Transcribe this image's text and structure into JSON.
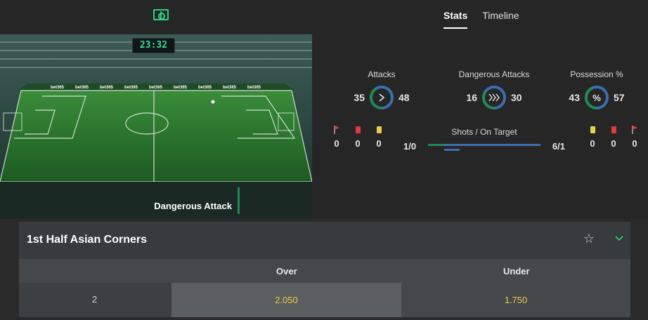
{
  "header": {
    "pitch_icon": "pitch-icon",
    "tabs": [
      {
        "label": "Stats",
        "active": true
      },
      {
        "label": "Timeline",
        "active": false
      }
    ]
  },
  "match": {
    "clock": "23:32",
    "event": "Dangerous Attack",
    "board_text": "bet365"
  },
  "stats": {
    "attacks": {
      "title": "Attacks",
      "home": "35",
      "away": "48",
      "icon": "chevron-right-icon"
    },
    "dangerous_attacks": {
      "title": "Dangerous Attacks",
      "home": "16",
      "away": "30",
      "icon": "triple-chevron-icon"
    },
    "possession": {
      "title": "Possession %",
      "home": "43",
      "away": "57",
      "icon": "percent-icon"
    },
    "home_cards": {
      "corners": "0",
      "red": "0",
      "yellow": "0"
    },
    "away_cards": {
      "yellow": "0",
      "red": "0",
      "corners": "0"
    },
    "shots": {
      "title": "Shots / On Target",
      "home": "1/0",
      "away": "6/1"
    }
  },
  "market": {
    "title": "1st Half Asian Corners",
    "columns": {
      "over": "Over",
      "under": "Under"
    },
    "rows": [
      {
        "line": "2",
        "over": "2.050",
        "under": "1.750"
      }
    ]
  },
  "colors": {
    "accent_green": "#2bd47a",
    "home_green": "#1e8a55",
    "away_blue": "#3a6fb0",
    "odds_yellow": "#f2c94c"
  }
}
